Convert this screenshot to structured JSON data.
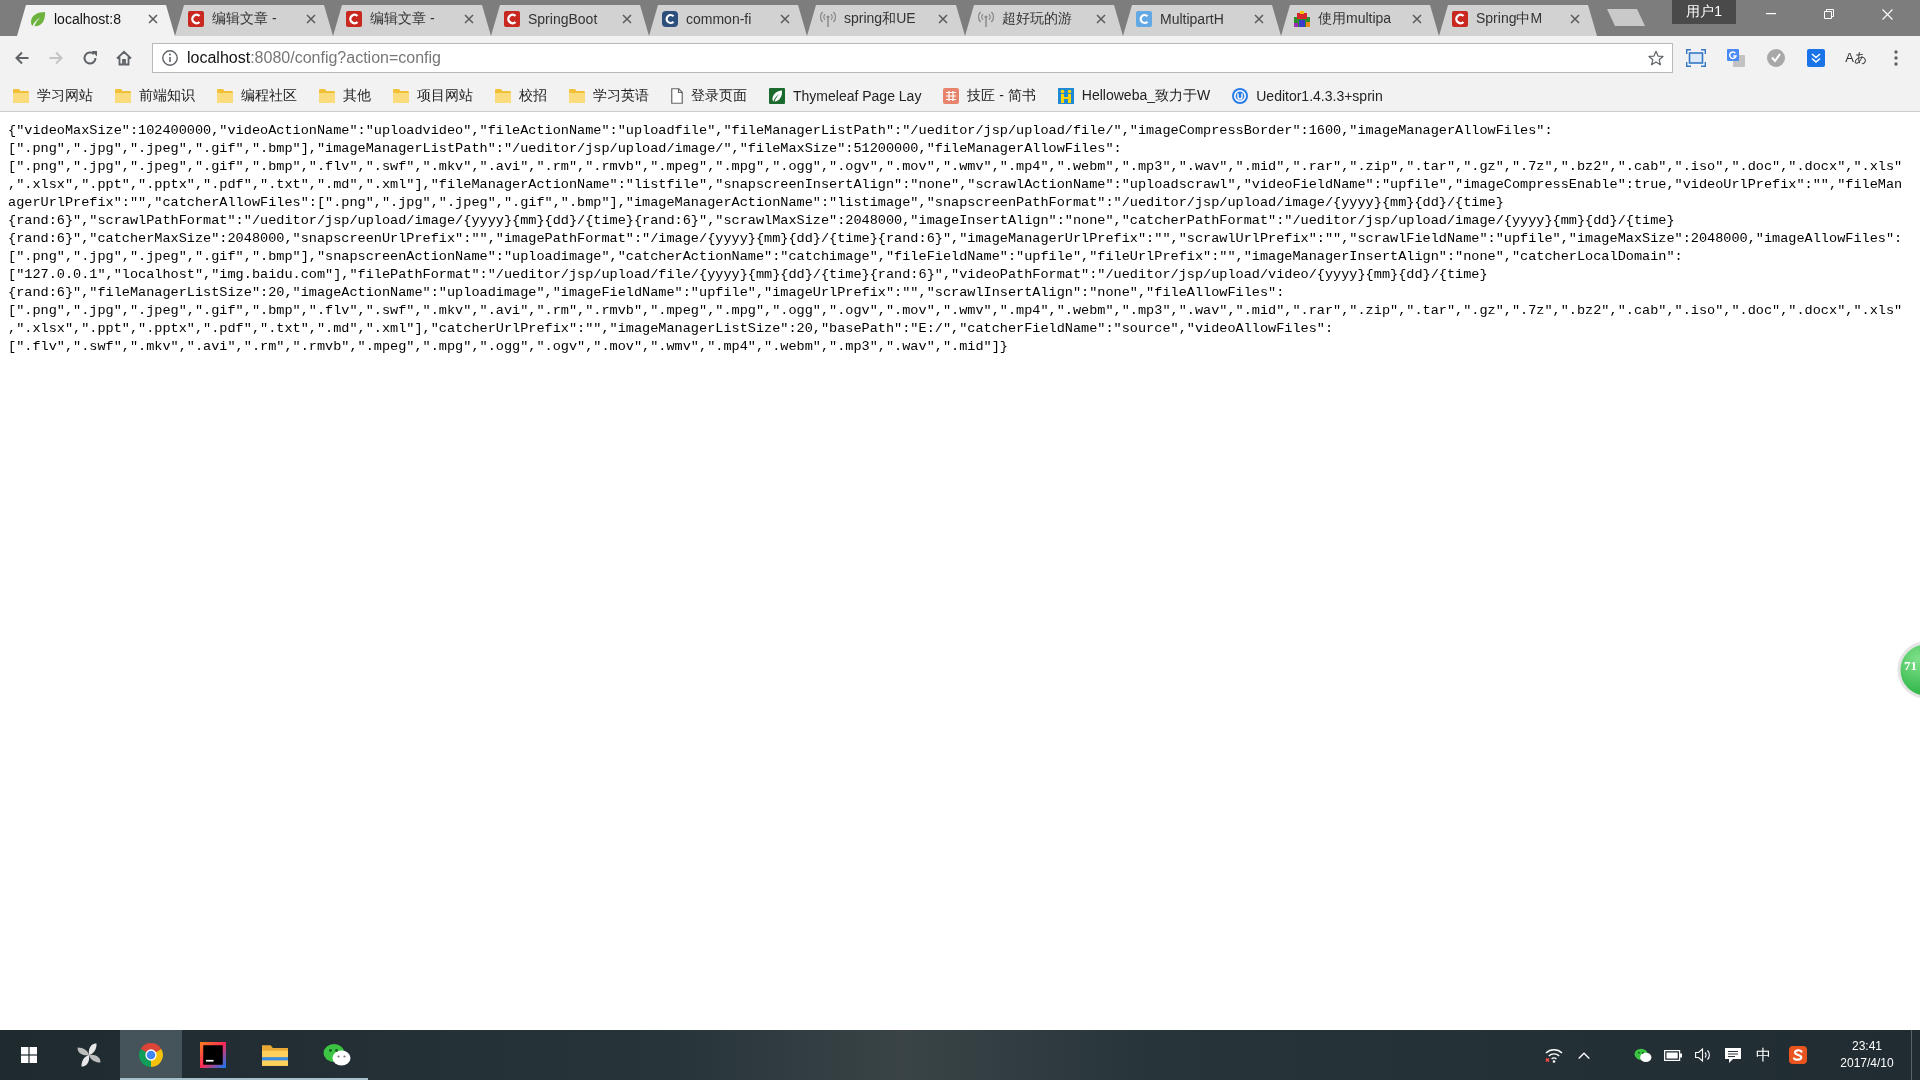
{
  "window": {
    "profile_name": "用户1"
  },
  "tabs": [
    {
      "title": "localhost:8",
      "selected": true
    },
    {
      "title": "编辑文章 -",
      "selected": false
    },
    {
      "title": "编辑文章 -",
      "selected": false
    },
    {
      "title": "SpringBoot",
      "selected": false
    },
    {
      "title": "common-fi",
      "selected": false
    },
    {
      "title": "spring和UE",
      "selected": false
    },
    {
      "title": "超好玩的游",
      "selected": false
    },
    {
      "title": "MultipartH",
      "selected": false
    },
    {
      "title": "使用multipa",
      "selected": false
    },
    {
      "title": "Spring中M",
      "selected": false
    }
  ],
  "toolbar": {
    "nav_buttons": [
      {
        "disabled": false
      },
      {
        "disabled": true
      },
      {
        "disabled": false
      },
      {
        "disabled": false
      }
    ],
    "address": {
      "host": "localhost",
      "rest": ":8080/config?action=config"
    },
    "bookmarked": false,
    "extension_text": "Aあ"
  },
  "bookmarks": [
    {
      "label": "学习网站",
      "kind": "folder"
    },
    {
      "label": "前端知识",
      "kind": "folder"
    },
    {
      "label": "编程社区",
      "kind": "folder"
    },
    {
      "label": "其他",
      "kind": "folder"
    },
    {
      "label": "项目网站",
      "kind": "folder"
    },
    {
      "label": "校招",
      "kind": "folder"
    },
    {
      "label": "学习英语",
      "kind": "folder"
    },
    {
      "label": "登录页面",
      "kind": "page"
    },
    {
      "label": "Thymeleaf Page Lay",
      "kind": "site"
    },
    {
      "label": "技匠 - 简书",
      "kind": "site"
    },
    {
      "label": "Helloweba_致力于W",
      "kind": "site"
    },
    {
      "label": "Ueditor1.4.3.3+sprin",
      "kind": "site"
    }
  ],
  "page": {
    "lines": [
      "{\"videoMaxSize\":102400000,\"videoActionName\":\"uploadvideo\",\"fileActionName\":\"uploadfile\",\"fileManagerListPath\":\"/ueditor/jsp/upload/file/\",\"imageCompressBorder\":1600,\"imageManagerAllowFiles\":",
      "[\".png\",\".jpg\",\".jpeg\",\".gif\",\".bmp\"],\"imageManagerListPath\":\"/ueditor/jsp/upload/image/\",\"fileMaxSize\":51200000,\"fileManagerAllowFiles\":",
      "[\".png\",\".jpg\",\".jpeg\",\".gif\",\".bmp\",\".flv\",\".swf\",\".mkv\",\".avi\",\".rm\",\".rmvb\",\".mpeg\",\".mpg\",\".ogg\",\".ogv\",\".mov\",\".wmv\",\".mp4\",\".webm\",\".mp3\",\".wav\",\".mid\",\".rar\",\".zip\",\".tar\",\".gz\",\".7z\",\".bz2\",\".cab\",\".iso\",\".doc\",\".docx\",\".xls\"",
      ",\".xlsx\",\".ppt\",\".pptx\",\".pdf\",\".txt\",\".md\",\".xml\"],\"fileManagerActionName\":\"listfile\",\"snapscreenInsertAlign\":\"none\",\"scrawlActionName\":\"uploadscrawl\",\"videoFieldName\":\"upfile\",\"imageCompressEnable\":true,\"videoUrlPrefix\":\"\",\"fileMan",
      "agerUrlPrefix\":\"\",\"catcherAllowFiles\":[\".png\",\".jpg\",\".jpeg\",\".gif\",\".bmp\"],\"imageManagerActionName\":\"listimage\",\"snapscreenPathFormat\":\"/ueditor/jsp/upload/image/{yyyy}{mm}{dd}/{time}",
      "{rand:6}\",\"scrawlPathFormat\":\"/ueditor/jsp/upload/image/{yyyy}{mm}{dd}/{time}{rand:6}\",\"scrawlMaxSize\":2048000,\"imageInsertAlign\":\"none\",\"catcherPathFormat\":\"/ueditor/jsp/upload/image/{yyyy}{mm}{dd}/{time}",
      "{rand:6}\",\"catcherMaxSize\":2048000,\"snapscreenUrlPrefix\":\"\",\"imagePathFormat\":\"/image/{yyyy}{mm}{dd}/{time}{rand:6}\",\"imageManagerUrlPrefix\":\"\",\"scrawlUrlPrefix\":\"\",\"scrawlFieldName\":\"upfile\",\"imageMaxSize\":2048000,\"imageAllowFiles\":",
      "[\".png\",\".jpg\",\".jpeg\",\".gif\",\".bmp\"],\"snapscreenActionName\":\"uploadimage\",\"catcherActionName\":\"catchimage\",\"fileFieldName\":\"upfile\",\"fileUrlPrefix\":\"\",\"imageManagerInsertAlign\":\"none\",\"catcherLocalDomain\":",
      "[\"127.0.0.1\",\"localhost\",\"img.baidu.com\"],\"filePathFormat\":\"/ueditor/jsp/upload/file/{yyyy}{mm}{dd}/{time}{rand:6}\",\"videoPathFormat\":\"/ueditor/jsp/upload/video/{yyyy}{mm}{dd}/{time}",
      "{rand:6}\",\"fileManagerListSize\":20,\"imageActionName\":\"uploadimage\",\"imageFieldName\":\"upfile\",\"imageUrlPrefix\":\"\",\"scrawlInsertAlign\":\"none\",\"fileAllowFiles\":",
      "[\".png\",\".jpg\",\".jpeg\",\".gif\",\".bmp\",\".flv\",\".swf\",\".mkv\",\".avi\",\".rm\",\".rmvb\",\".mpeg\",\".mpg\",\".ogg\",\".ogv\",\".mov\",\".wmv\",\".mp4\",\".webm\",\".mp3\",\".wav\",\".mid\",\".rar\",\".zip\",\".tar\",\".gz\",\".7z\",\".bz2\",\".cab\",\".iso\",\".doc\",\".docx\",\".xls\"",
      ",\".xlsx\",\".ppt\",\".pptx\",\".pdf\",\".txt\",\".md\",\".xml\"],\"catcherUrlPrefix\":\"\",\"imageManagerListSize\":20,\"basePath\":\"E:/\",\"catcherFieldName\":\"source\",\"videoAllowFiles\":",
      "[\".flv\",\".swf\",\".mkv\",\".avi\",\".rm\",\".rmvb\",\".mpeg\",\".mpg\",\".ogg\",\".ogv\",\".mov\",\".wmv\",\".mp4\",\".webm\",\".mp3\",\".wav\",\".mid\"]}"
    ]
  },
  "floating_ball": {
    "value": "71"
  },
  "taskbar": {
    "apps": [
      {
        "running": false,
        "selected": false
      },
      {
        "running": true,
        "selected": true
      },
      {
        "running": true,
        "selected": false
      },
      {
        "running": true,
        "selected": false
      },
      {
        "running": true,
        "selected": false
      }
    ],
    "ime": "中",
    "time": "23:41",
    "date": "2017/4/10"
  }
}
